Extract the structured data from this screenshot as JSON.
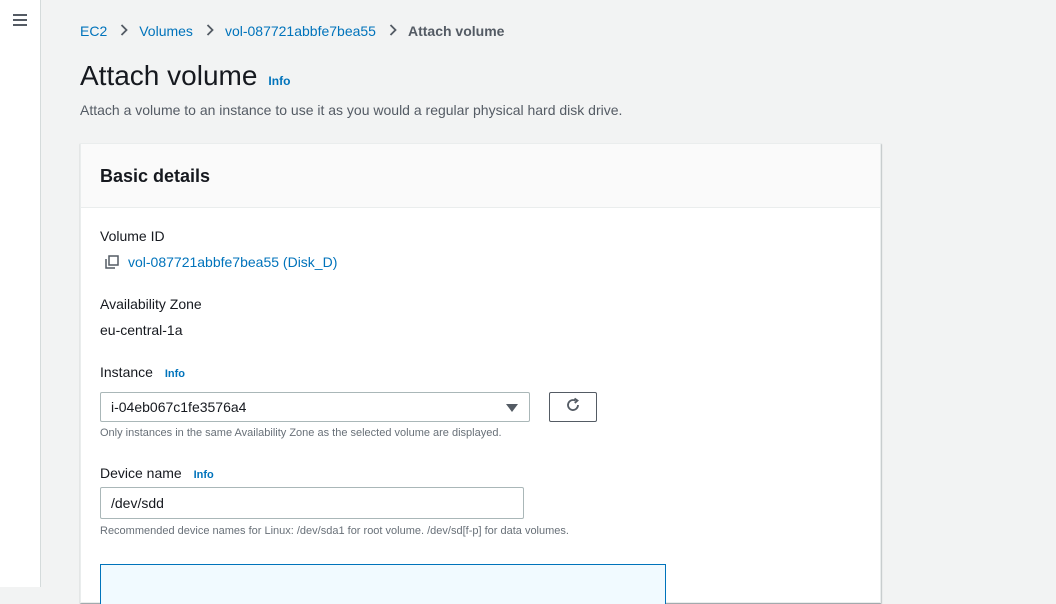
{
  "nav": {
    "menu_label": "Menu"
  },
  "breadcrumb": {
    "items": [
      "EC2",
      "Volumes",
      "vol-087721abbfe7bea55"
    ],
    "current": "Attach volume"
  },
  "page": {
    "title": "Attach volume",
    "info_label": "Info",
    "description": "Attach a volume to an instance to use it as you would a regular physical hard disk drive."
  },
  "panel": {
    "heading": "Basic details",
    "volume_id": {
      "label": "Volume ID",
      "value": "vol-087721abbfe7bea55 (Disk_D)"
    },
    "availability_zone": {
      "label": "Availability Zone",
      "value": "eu-central-1a"
    },
    "instance": {
      "label": "Instance",
      "info_label": "Info",
      "selected": "i-04eb067c1fe3576a4",
      "hint": "Only instances in the same Availability Zone as the selected volume are displayed."
    },
    "device_name": {
      "label": "Device name",
      "info_label": "Info",
      "value": "/dev/sdd",
      "hint": "Recommended device names for Linux: /dev/sda1 for root volume. /dev/sd[f-p] for data volumes."
    }
  },
  "colors": {
    "link": "#0073bb",
    "background": "#f2f3f3",
    "panel_header": "#fafafa",
    "info_box": "#f1faff"
  },
  "icons": {
    "menu": "hamburger-icon",
    "separator": "chevron-right-icon",
    "copy": "copy-icon",
    "caret": "caret-down-icon",
    "refresh": "refresh-icon"
  }
}
